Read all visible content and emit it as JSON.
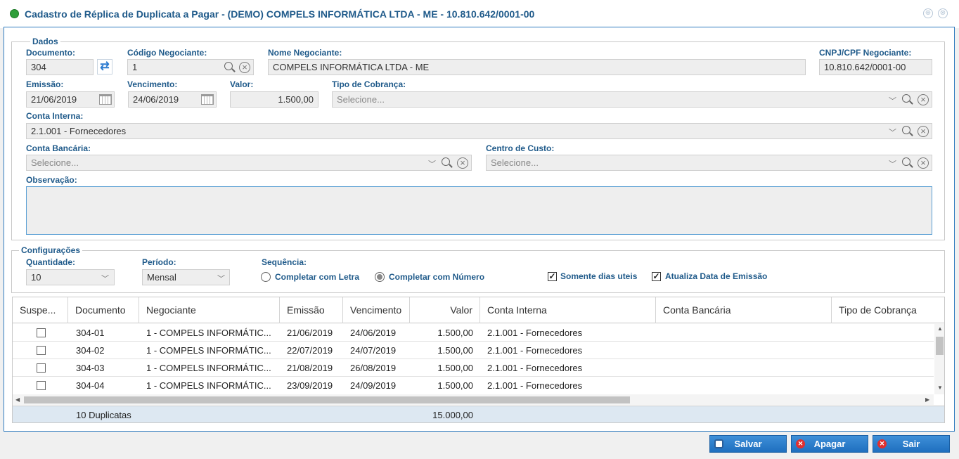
{
  "window": {
    "title": "Cadastro de Réplica de Duplicata a Pagar - (DEMO) COMPELS INFORMÁTICA LTDA - ME - 10.810.642/0001-00",
    "ctrl_restore": "⊕",
    "ctrl_close": "⊗"
  },
  "dados": {
    "legend": "Dados",
    "documento": {
      "label": "Documento:",
      "value": "304"
    },
    "codigo_negociante": {
      "label": "Código Negociante:",
      "value": "1"
    },
    "nome_negociante": {
      "label": "Nome Negociante:",
      "value": "COMPELS INFORMÁTICA LTDA - ME"
    },
    "cnpj": {
      "label": "CNPJ/CPF Negociante:",
      "value": "10.810.642/0001-00"
    },
    "emissao": {
      "label": "Emissão:",
      "value": "21/06/2019"
    },
    "vencimento": {
      "label": "Vencimento:",
      "value": "24/06/2019"
    },
    "valor": {
      "label": "Valor:",
      "value": "1.500,00"
    },
    "tipo_cobranca": {
      "label": "Tipo de Cobrança:",
      "placeholder": "Selecione..."
    },
    "conta_interna": {
      "label": "Conta Interna:",
      "value": "2.1.001 - Fornecedores"
    },
    "conta_bancaria": {
      "label": "Conta Bancária:",
      "placeholder": "Selecione..."
    },
    "centro_custo": {
      "label": "Centro de Custo:",
      "placeholder": "Selecione..."
    },
    "observacao": {
      "label": "Observação:",
      "value": ""
    }
  },
  "config": {
    "legend": "Configurações",
    "quantidade": {
      "label": "Quantidade:",
      "value": "10"
    },
    "periodo": {
      "label": "Período:",
      "value": "Mensal"
    },
    "sequencia": {
      "label": "Sequência:",
      "options": [
        {
          "label": "Completar com Letra",
          "selected": false
        },
        {
          "label": "Completar com Número",
          "selected": true
        }
      ]
    },
    "somente_dias_uteis": {
      "label": "Somente dias uteis",
      "checked": true
    },
    "atualiza_data": {
      "label": "Atualiza Data de Emissão",
      "checked": true
    }
  },
  "grid": {
    "columns": [
      "Suspe...",
      "Documento",
      "Negociante",
      "Emissão",
      "Vencimento",
      "Valor",
      "Conta Interna",
      "Conta Bancária",
      "Tipo de Cobrança"
    ],
    "rows": [
      {
        "documento": "304-01",
        "negociante": "1 - COMPELS INFORMÁTIC...",
        "emissao": "21/06/2019",
        "vencimento": "24/06/2019",
        "valor": "1.500,00",
        "conta_interna": "2.1.001 - Fornecedores"
      },
      {
        "documento": "304-02",
        "negociante": "1 - COMPELS INFORMÁTIC...",
        "emissao": "22/07/2019",
        "vencimento": "24/07/2019",
        "valor": "1.500,00",
        "conta_interna": "2.1.001 - Fornecedores"
      },
      {
        "documento": "304-03",
        "negociante": "1 - COMPELS INFORMÁTIC...",
        "emissao": "21/08/2019",
        "vencimento": "26/08/2019",
        "valor": "1.500,00",
        "conta_interna": "2.1.001 - Fornecedores"
      },
      {
        "documento": "304-04",
        "negociante": "1 - COMPELS INFORMÁTIC...",
        "emissao": "23/09/2019",
        "vencimento": "24/09/2019",
        "valor": "1.500,00",
        "conta_interna": "2.1.001 - Fornecedores"
      }
    ],
    "footer": {
      "count": "10 Duplicatas",
      "total": "15.000,00"
    }
  },
  "buttons": {
    "salvar": "Salvar",
    "apagar": "Apagar",
    "sair": "Sair"
  }
}
